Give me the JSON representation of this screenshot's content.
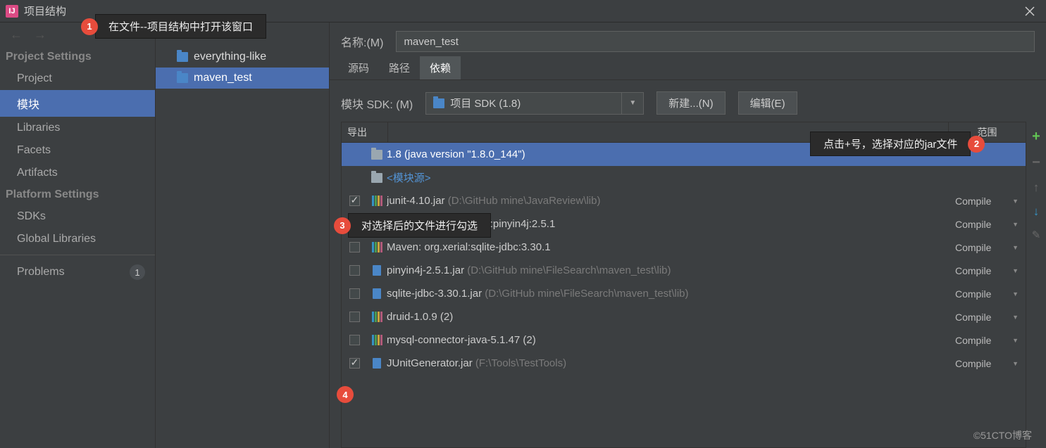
{
  "window": {
    "title": "项目结构"
  },
  "callouts": {
    "c1": "在文件--项目结构中打开该窗口",
    "c2": "点击+号，选择对应的jar文件",
    "c3": "对选择后的文件进行勾选",
    "n1": "1",
    "n2": "2",
    "n3": "3",
    "n4": "4"
  },
  "sidebar": {
    "project_settings": "Project Settings",
    "items_ps": [
      "Project",
      "模块",
      "Libraries",
      "Facets",
      "Artifacts"
    ],
    "platform_settings": "Platform Settings",
    "items_pl": [
      "SDKs",
      "Global Libraries"
    ],
    "problems": "Problems",
    "problems_count": "1"
  },
  "modules": {
    "items": [
      "everything-like",
      "maven_test"
    ]
  },
  "form": {
    "name_label": "名称:(M)",
    "name_value": "maven_test",
    "tabs": [
      "源码",
      "路径",
      "依赖"
    ],
    "sdk_label": "模块 SDK:  (M)",
    "sdk_value": "项目 SDK (1.8)",
    "new_btn": "新建...(N)",
    "edit_btn": "编辑(E)"
  },
  "table": {
    "header_export": "导出",
    "header_scope": "范围",
    "rows": [
      {
        "checked": false,
        "icon": "folder",
        "name": "1.8 (java version \"1.8.0_144\")",
        "dim": "",
        "scope": "",
        "selected": true,
        "showCheck": false
      },
      {
        "checked": false,
        "icon": "folder",
        "name": "<模块源>",
        "dim": "",
        "scope": "",
        "link": true,
        "showCheck": false
      },
      {
        "checked": true,
        "icon": "lib",
        "name": "junit-4.10.jar",
        "dim": " (D:\\GitHub mine\\JavaReview\\lib)",
        "scope": "Compile"
      },
      {
        "checked": false,
        "icon": "lib",
        "name": "Maven: com.belerweb:pinyin4j:2.5.1",
        "dim": "",
        "scope": "Compile"
      },
      {
        "checked": false,
        "icon": "lib",
        "name": "Maven: org.xerial:sqlite-jdbc:3.30.1",
        "dim": "",
        "scope": "Compile"
      },
      {
        "checked": false,
        "icon": "jar",
        "name": "pinyin4j-2.5.1.jar",
        "dim": " (D:\\GitHub mine\\FileSearch\\maven_test\\lib)",
        "scope": "Compile"
      },
      {
        "checked": false,
        "icon": "jar",
        "name": "sqlite-jdbc-3.30.1.jar",
        "dim": " (D:\\GitHub mine\\FileSearch\\maven_test\\lib)",
        "scope": "Compile"
      },
      {
        "checked": false,
        "icon": "lib",
        "name": "druid-1.0.9 (2)",
        "dim": "",
        "scope": "Compile"
      },
      {
        "checked": false,
        "icon": "lib",
        "name": "mysql-connector-java-5.1.47 (2)",
        "dim": "",
        "scope": "Compile"
      },
      {
        "checked": true,
        "icon": "jar",
        "name": "JUnitGenerator.jar",
        "dim": " (F:\\Tools\\TestTools)",
        "scope": "Compile"
      }
    ]
  },
  "watermark": "©51CTO博客"
}
